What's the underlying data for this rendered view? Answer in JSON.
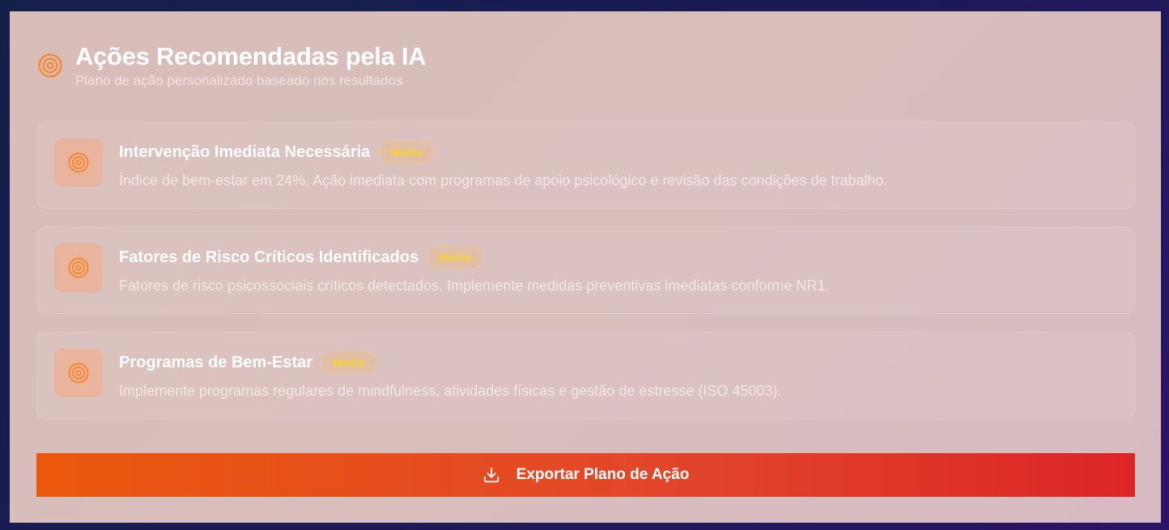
{
  "header": {
    "icon": "target-icon",
    "title": "Ações Recomendadas pela IA",
    "subtitle": "Plano de ação personalizado baseado nos resultados"
  },
  "actions": [
    {
      "icon": "target-icon",
      "title": "Intervenção Imediata Necessária",
      "badge": "Média",
      "description": "Índice de bem-estar em 24%. Ação imediata com programas de apoio psicológico e revisão das condições de trabalho."
    },
    {
      "icon": "target-icon",
      "title": "Fatores de Risco Críticos Identificados",
      "badge": "Média",
      "description": "Fatores de risco psicossociais críticos detectados. Implemente medidas preventivas imediatas conforme NR1."
    },
    {
      "icon": "target-icon",
      "title": "Programas de Bem-Estar",
      "badge": "Média",
      "description": "Implemente programas regulares de mindfulness, atividades físicas e gestão de estresse (ISO 45003)."
    }
  ],
  "export_button": {
    "icon": "download-icon",
    "label": "Exportar Plano de Ação"
  },
  "colors": {
    "accent_orange": "#f97316",
    "badge_text": "#f5d22e",
    "button_gradient_start": "#ea580c",
    "button_gradient_end": "#dc2626"
  }
}
